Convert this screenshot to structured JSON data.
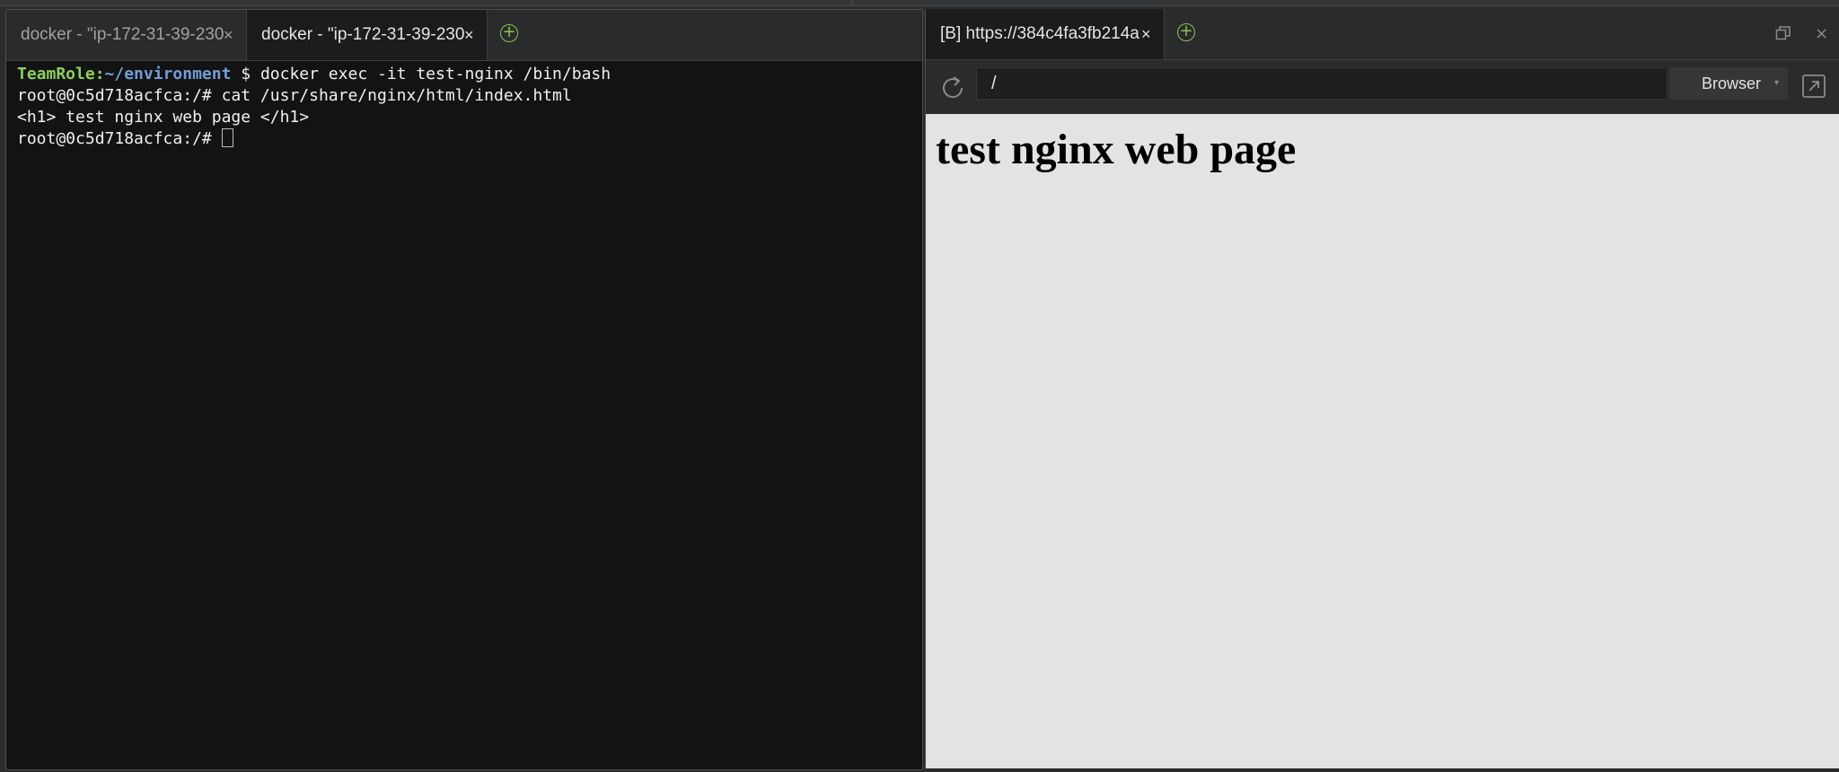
{
  "terminal_pane": {
    "tabs": [
      {
        "label": "docker - \"ip-172-31-39-230",
        "close": "×",
        "active": false
      },
      {
        "label": "docker - \"ip-172-31-39-230",
        "close": "×",
        "active": true
      }
    ],
    "add_tab": "+",
    "lines": {
      "line1": {
        "user": "TeamRole",
        "sep": ":",
        "dir": "~/environment",
        "cmd": " $ docker exec -it test-nginx /bin/bash"
      },
      "line2": "root@0c5d718acfca:/# cat /usr/share/nginx/html/index.html",
      "line3": "<h1> test nginx web page </h1>",
      "line4": "root@0c5d718acfca:/# "
    }
  },
  "browser_pane": {
    "tab": {
      "label": "[B] https://384c4fa3fb214a",
      "close": "×"
    },
    "add_tab": "+",
    "window_close": "×",
    "url": "/",
    "mode": "Browser",
    "page_heading": "test nginx web page"
  }
}
